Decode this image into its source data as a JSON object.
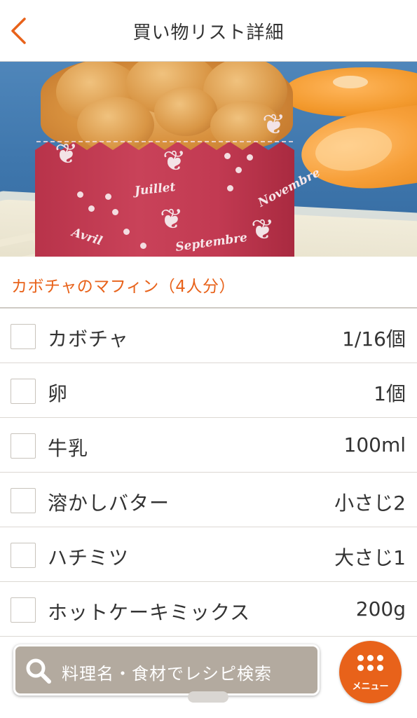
{
  "header": {
    "title": "買い物リスト詳細",
    "back_icon": "chevron-left-icon",
    "accent_color": "#e8621a"
  },
  "hero_image": {
    "description_icon": "pumpkin-muffin-photo",
    "cup_text": [
      "Juillet",
      "Novembre",
      "Avril",
      "Septembre"
    ]
  },
  "recipe": {
    "title": "カボチャのマフィン（4人分）"
  },
  "ingredients": [
    {
      "name": "カボチャ",
      "quantity": "1/16個",
      "checked": false
    },
    {
      "name": "卵",
      "quantity": "1個",
      "checked": false
    },
    {
      "name": "牛乳",
      "quantity": "100ml",
      "checked": false
    },
    {
      "name": "溶かしバター",
      "quantity": "小さじ2",
      "checked": false
    },
    {
      "name": "ハチミツ",
      "quantity": "大さじ1",
      "checked": false
    },
    {
      "name": "ホットケーキミックス",
      "quantity": "200g",
      "checked": false
    }
  ],
  "search": {
    "placeholder": "料理名・食材でレシピ検索",
    "icon": "search-icon",
    "background_color": "#b3aa9f"
  },
  "menu": {
    "label": "メニュー",
    "icon": "grid-dots-icon",
    "color": "#e8621a"
  }
}
